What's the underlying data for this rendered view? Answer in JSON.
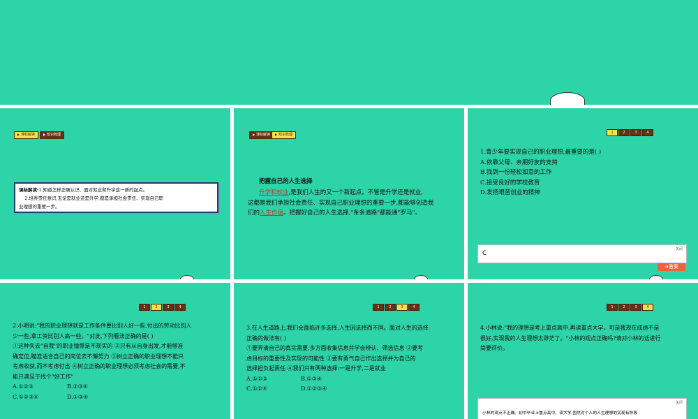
{
  "tags": {
    "standard": "课标解读",
    "knowledge": "知识梳理"
  },
  "pager": [
    "1",
    "2",
    "3",
    "4"
  ],
  "slide1": {
    "label": "课标解读:",
    "line1": "1.知道怎样正确认识、面对就业和升学这一新的起点。",
    "line2": "2.培养责任意识,无论是就业还是升学,都是承担社会责任、实现自己职",
    "line3": "业理想的重要一步。"
  },
  "slide2": {
    "heading": "把握自己的人生选择",
    "fill1": "升学和就业",
    "p1": ",是我们人生的又一个新起点。不管是升学还是就业,",
    "p2": "这都是我们承担社会责任、实现自己职业理想的重要一步,都能够创造我",
    "p3_pre": "们的",
    "fill2": "人生价值",
    "p3_post": "。把握好自己的人生选择,\"条条道路\"都能通\"罗马\"。"
  },
  "slide3": {
    "q": "1.青少年要实现自己的职业理想,最重要的是(        )",
    "a": "A.依靠父母、亲朋好友的支持",
    "b": "B.找到一份轻松如意的工作",
    "c": "C.接受良好的学校教育",
    "d": "D.发扬艰苦创业的精神",
    "answer": "C",
    "close": "关闭",
    "answer_btn": "答案"
  },
  "slide4": {
    "l1": "2.小明说:\"我的职业理想就是工作条件要比别人好一些,付出的劳动比别人",
    "l2": "少一些,拿工资比别人高一些。\"对此,下列看法正确的是(        )",
    "l3": "①这种失去\"自我\"的职业憧憬是不现实的    ②只有从自身出发,才能够准",
    "l4": "确定位,瞄准适合自己的岗位去不懈努力    ③树立正确的职业理想不能只",
    "l5": "考虑收获,而不考虑付出    ④树立正确的职业理想必须考虑社会的需要,不",
    "l6": "能只满足于找个\"好工作\"",
    "oa": "A.①②③",
    "ob": "B.②③④",
    "oc": "C.①②③④",
    "od": "D.①③④"
  },
  "slide5": {
    "l1": "3.在人生道路上,我们会面临许多选择,人生因选择而不同。面对人生的选择",
    "l2": "正确的做法有(        )",
    "l3": "①要弄清自己的真实需要,多方面收集信息并学会辨认、筛选信息    ②要考",
    "l4": "虑目标的重要性及实现的可能性    ③要有勇气自己作出选择并为自己的",
    "l5": "选择担负起责任    ④我们只有两种选择:一是升学,二是就业",
    "oa": "A.①②③",
    "ob": "B.①③④",
    "oc": "C.①②④",
    "od": "D.①②③④"
  },
  "slide6": {
    "l1": "4.小林说:\"我的理想是考上重点高中,再读重点大学。可是我现在成绩不是",
    "l2": "很好,实现我的人生理想太渺茫了。\"小林的观点正确吗?请对小林的话进行",
    "l3": "简要评价。",
    "close": "关闭",
    "answer": "小林的观点不正确。初中毕业上重点高中、读大学,固然对个人的人生理想的实现有积极"
  },
  "colors": {
    "slide_bg": "#2dd4a8",
    "tag_bg": "#6b2f12",
    "tag_active": "#f4e04d",
    "answer_btn": "#e8643a",
    "fill_text": "#c0392b"
  }
}
